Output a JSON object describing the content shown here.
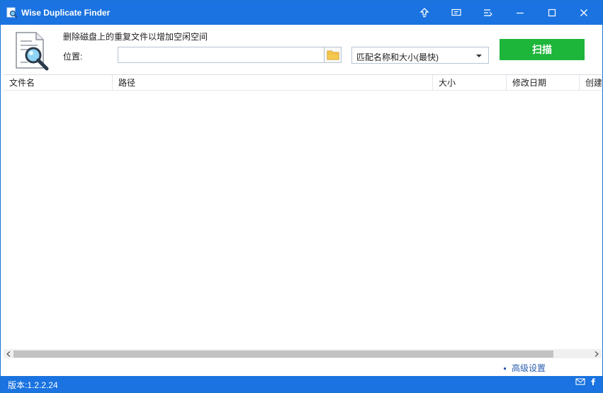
{
  "window": {
    "title": "Wise Duplicate Finder",
    "accent_color": "#1a73e0",
    "scan_color": "#1db53a"
  },
  "titlebar": {
    "buttons": [
      {
        "name": "upgrade-icon"
      },
      {
        "name": "feedback-icon"
      },
      {
        "name": "menu-icon"
      },
      {
        "name": "minimize-icon"
      },
      {
        "name": "maximize-icon"
      },
      {
        "name": "close-icon"
      }
    ]
  },
  "header": {
    "description": "删除磁盘上的重复文件以增加空闲空间",
    "location_label": "位置:",
    "location_value": "",
    "match_mode": "匹配名称和大小(最快)",
    "scan_label": "扫描"
  },
  "table": {
    "columns": [
      "文件名",
      "路径",
      "大小",
      "修改日期",
      "创建"
    ]
  },
  "footer": {
    "advanced_settings": "高级设置",
    "version": "版本:1.2.2.24"
  }
}
